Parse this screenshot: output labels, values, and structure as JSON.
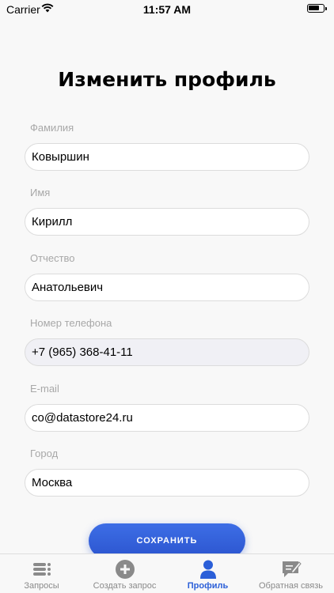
{
  "status_bar": {
    "carrier": "Carrier",
    "time": "11:57 AM"
  },
  "page": {
    "title": "Изменить профиль"
  },
  "form": {
    "fields": [
      {
        "label": "Фамилия",
        "value": "Ковыршин"
      },
      {
        "label": "Имя",
        "value": "Кирилл"
      },
      {
        "label": "Отчество",
        "value": "Анатольевич"
      },
      {
        "label": "Номер телефона",
        "value": "+7 (965) 368-41-11"
      },
      {
        "label": "E-mail",
        "value": "co@datastore24.ru"
      },
      {
        "label": "Город",
        "value": "Москва"
      }
    ],
    "save_label": "СОХРАНИТЬ"
  },
  "tabs": [
    {
      "label": "Запросы",
      "icon": "list-icon",
      "active": false
    },
    {
      "label": "Создать запрос",
      "icon": "add-circle-icon",
      "active": false
    },
    {
      "label": "Профиль",
      "icon": "profile-icon",
      "active": true
    },
    {
      "label": "Обратная связь",
      "icon": "feedback-icon",
      "active": false
    }
  ],
  "colors": {
    "accent": "#2b5fd8",
    "tab_inactive": "#8a8a8a",
    "label": "#a8a8a8",
    "background": "#f8f8f8"
  }
}
